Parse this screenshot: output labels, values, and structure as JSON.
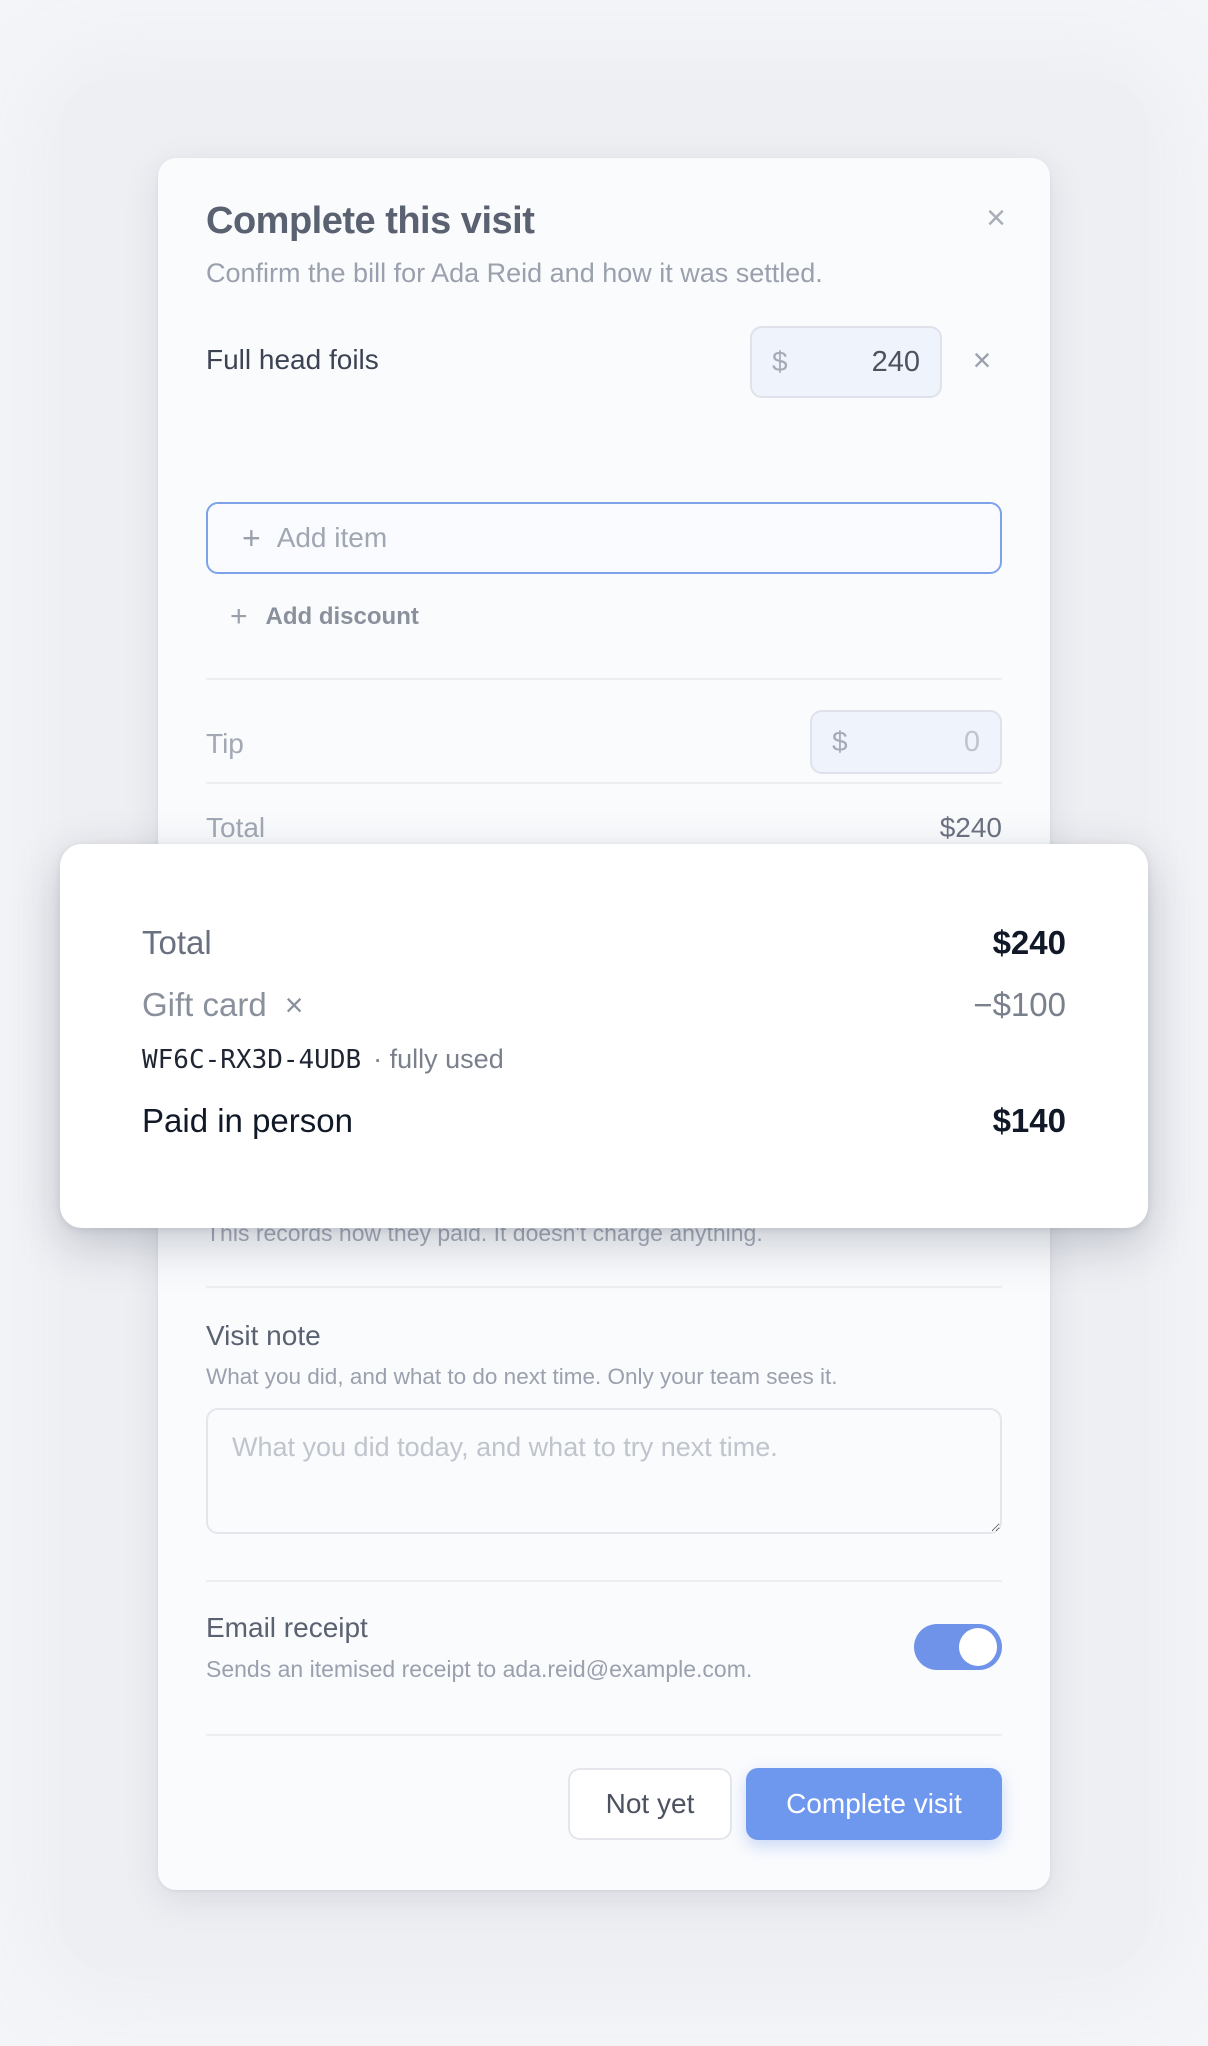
{
  "modal": {
    "title": "Complete this visit",
    "subtitle": "Confirm the bill for Ada Reid and how it was settled.",
    "close_icon": "×"
  },
  "line_item": {
    "name": "Full head foils",
    "currency": "$",
    "price": "240",
    "remove_icon": "×"
  },
  "add_item": {
    "plus": "+",
    "placeholder": "Add item"
  },
  "add_discount": {
    "plus": "+",
    "label": "Add discount"
  },
  "tip": {
    "label": "Tip",
    "currency": "$",
    "placeholder": "0"
  },
  "total": {
    "label": "Total",
    "value": "$240"
  },
  "summary": {
    "total_label": "Total",
    "total_value": "$240",
    "gift_label": "Gift card",
    "gift_remove_icon": "×",
    "gift_value": "−$100",
    "gift_code": "WF6C-RX3D-4UDB",
    "gift_status": "· fully used",
    "paid_label": "Paid in person",
    "paid_value": "$140"
  },
  "records_note": "This records how they paid. It doesn't charge anything.",
  "visit_note": {
    "label": "Visit note",
    "help": "What you did, and what to do next time. Only your team sees it.",
    "placeholder": "What you did today, and what to try next time."
  },
  "email_receipt": {
    "label": "Email receipt",
    "help": "Sends an itemised receipt to ada.reid@example.com.",
    "enabled": true
  },
  "buttons": {
    "not_yet": "Not yet",
    "complete": "Complete visit"
  },
  "colors": {
    "accent": "#6e97ee",
    "input_border_focus": "#7ea2ea",
    "text_dark": "#111827"
  }
}
